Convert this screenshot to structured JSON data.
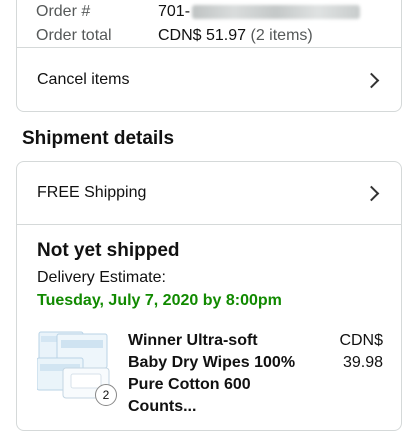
{
  "order": {
    "number_label": "Order #",
    "number_prefix": "701-",
    "total_label": "Order total",
    "total_value": "CDN$ 51.97",
    "item_count": "(2 items)"
  },
  "actions": {
    "cancel_label": "Cancel items"
  },
  "shipment": {
    "section_title": "Shipment details",
    "shipping_option": "FREE Shipping",
    "status": "Not yet shipped",
    "estimate_label": "Delivery Estimate:",
    "estimate_date": "Tuesday, July 7, 2020 by 8:00pm"
  },
  "product": {
    "title": "Winner Ultra-soft Baby Dry Wipes 100% Pure Cotton 600 Counts...",
    "price_currency": "CDN$",
    "price_value": "39.98",
    "quantity": "2"
  },
  "colors": {
    "accent_green": "#118a00",
    "border": "#d5d9d9"
  }
}
